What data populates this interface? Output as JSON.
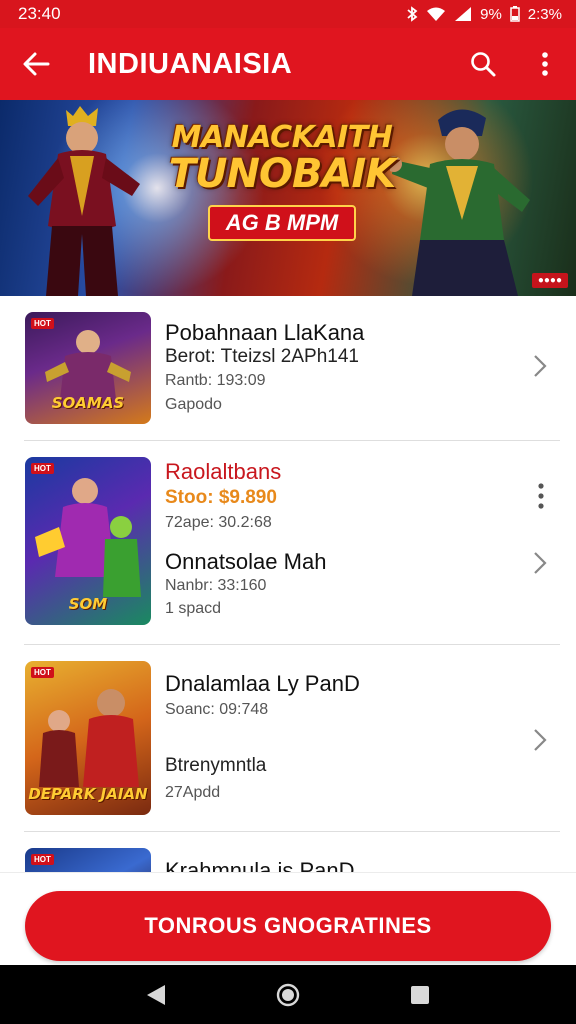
{
  "status_bar": {
    "time": "23:40",
    "battery": "9%",
    "battery_extra": "2:3%"
  },
  "app_bar": {
    "title": "INDIUANAISIA"
  },
  "banner": {
    "title_line1": "MANACKAITH",
    "title_line2": "TUNOBAIK",
    "pill": "AG B MPM"
  },
  "list": [
    {
      "title": "Pobahnaan LlaKana",
      "subtitle": "Berot: Tteizsl 2APh141",
      "meta1": "Rantb: 193:09",
      "meta2": "Gapodo",
      "thumb_caption": "SOAMAS"
    },
    {
      "title": "Raolaltbans",
      "price": "Stoo: $9.890",
      "meta0": "72ape: 30.2:68",
      "title2": "Onnatsolae Mah",
      "meta1": "Nanbr: 33:160",
      "meta2": "1 spacd",
      "thumb_caption": "SOM"
    },
    {
      "title": "Dnalamlaa Ly PanD",
      "meta0": "Soanc: 09:748",
      "subtitle": "Btrenymntla",
      "meta1": "27Apdd",
      "thumb_caption": "DEPARK JAIAN"
    },
    {
      "title": "Krahmnula is PanD"
    }
  ],
  "cta": {
    "label": "TONROUS GNOGRATINES"
  },
  "colors": {
    "accent": "#e0151f",
    "status": "#d8151d",
    "highlight": "#e8891b"
  }
}
